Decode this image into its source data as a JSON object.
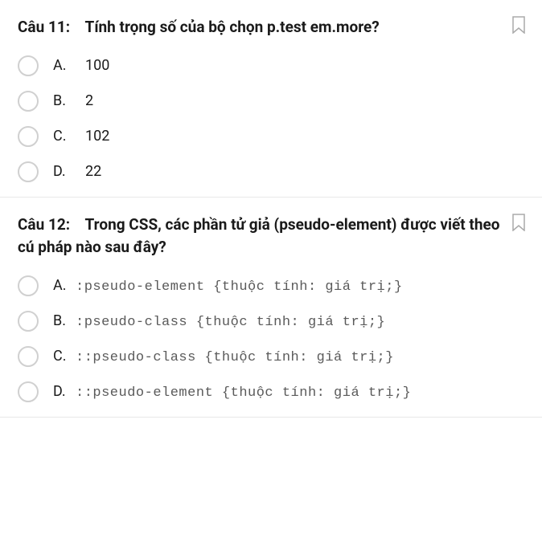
{
  "questions": [
    {
      "number": "Câu 11:",
      "text": "Tính trọng số của bộ chọn p.test em.more?",
      "options": [
        {
          "letter": "A.",
          "text": "100",
          "code": false
        },
        {
          "letter": "B.",
          "text": "2",
          "code": false
        },
        {
          "letter": "C.",
          "text": "102",
          "code": false
        },
        {
          "letter": "D.",
          "text": "22",
          "code": false
        }
      ]
    },
    {
      "number": "Câu 12:",
      "text": "Trong CSS, các phần tử giả (pseudo-element) được viết theo cú pháp nào sau đây?",
      "options": [
        {
          "letter": "A.",
          "text": ":pseudo-element {thuộc tính: giá trị;}",
          "code": true
        },
        {
          "letter": "B.",
          "text": ":pseudo-class {thuộc tính: giá trị;}",
          "code": true
        },
        {
          "letter": "C.",
          "text": "::pseudo-class {thuộc tính: giá trị;}",
          "code": true
        },
        {
          "letter": "D.",
          "text": "::pseudo-element {thuộc tính: giá trị;}",
          "code": true
        }
      ]
    }
  ]
}
